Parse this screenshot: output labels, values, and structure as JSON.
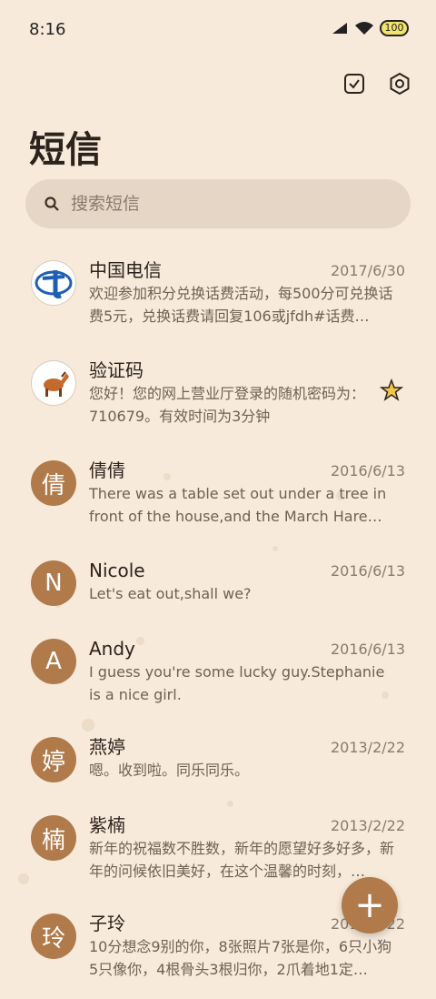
{
  "status_bar": {
    "time": "8:16",
    "battery": "100"
  },
  "header": {
    "title": "短信"
  },
  "search": {
    "placeholder": "搜索短信"
  },
  "conversations": [
    {
      "name": "中国电信",
      "date": "2017/6/30",
      "preview": "欢迎参加积分兑换话费活动，每500分可兑换话费5元，兑换话费请回复106或jfdh#话费…",
      "avatar": "china-telecom-logo"
    },
    {
      "name": "验证码",
      "date": "",
      "preview": "您好！您的网上营业厅登录的随机密码为：710679。有效时间为3分钟",
      "avatar": "horse-picture",
      "starred": true
    },
    {
      "name": "倩倩",
      "date": "2016/6/13",
      "preview": "There was a table set out under a tree in front of the house,and the March Hare an…",
      "avatar_letter": "倩"
    },
    {
      "name": "Nicole",
      "date": "2016/6/13",
      "preview": "Let's eat out,shall we?",
      "avatar_letter": "N"
    },
    {
      "name": "Andy",
      "date": "2016/6/13",
      "preview": "I guess you're some lucky guy.Stephanie is a nice girl.",
      "avatar_letter": "A"
    },
    {
      "name": "燕婷",
      "date": "2013/2/22",
      "preview": "嗯。收到啦。同乐同乐。",
      "avatar_letter": "婷"
    },
    {
      "name": "紫楠",
      "date": "2013/2/22",
      "preview": "新年的祝福数不胜数，新年的愿望好多好多，新年的问候依旧美好，在这个温馨的时刻，…",
      "avatar_letter": "楠"
    },
    {
      "name": "子玲",
      "date": "2013/2/22",
      "preview": "10分想念9别的你，8张照片7张是你，6只小狗5只像你，4根骨头3根归你，2爪着地1定…",
      "avatar_letter": "玲"
    }
  ],
  "fab": {
    "label": "+"
  }
}
